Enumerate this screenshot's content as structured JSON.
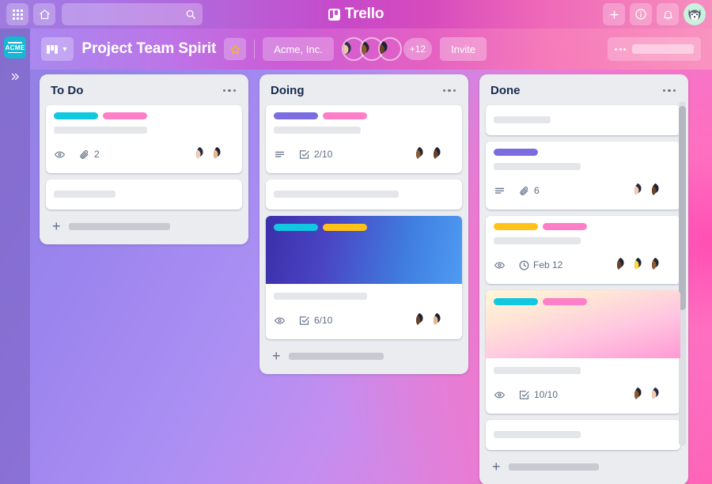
{
  "topnav": {
    "apps_icon": "grid-apps-icon",
    "home_icon": "home-icon",
    "search": {
      "value": "",
      "placeholder": "",
      "icon": "search-icon"
    },
    "brand": {
      "text": "Trello",
      "logo_icon": "trello-logo-icon"
    },
    "add_icon": "plus-icon",
    "info_icon": "info-icon",
    "notifications_icon": "bell-icon",
    "profile_avatar": "husky-avatar",
    "colors": {
      "gradient_start": "#9f7be0",
      "gradient_end": "#f58fbe"
    }
  },
  "sidebar": {
    "workspace_logo_text": "ACME",
    "workspace_logo_color": "#17b8d4",
    "expand_icon": "chevron-double-right-icon"
  },
  "boardbar": {
    "board_switch_icon": "board-icon",
    "board_switch_chevron": "chevron-down-icon",
    "title": "Project Team Spirit",
    "star_icon": "star-icon",
    "organization": "Acme, Inc.",
    "members_overflow": "+12",
    "invite_label": "Invite",
    "overflow_menu_icon": "ellipsis-icon",
    "members": [
      {
        "name": "member-1"
      },
      {
        "name": "member-2"
      },
      {
        "name": "member-3"
      }
    ]
  },
  "lists": [
    {
      "title": "To Do",
      "menu_icon": "ellipsis-icon",
      "has_scrollbar": false,
      "add_card_label": "",
      "cards": [
        {
          "cover": null,
          "labels": [
            "#12c7e0",
            "#ff7ec8"
          ],
          "title_placeholder_width": 118,
          "badges": [
            {
              "icon": "eye-icon",
              "text": ""
            },
            {
              "icon": "attachment-icon",
              "text": "2"
            }
          ],
          "avatars": [
            "member-4",
            "member-5"
          ]
        },
        {
          "cover": null,
          "labels": [],
          "title_placeholder_width": 78,
          "badges": [],
          "avatars": []
        }
      ]
    },
    {
      "title": "Doing",
      "menu_icon": "ellipsis-icon",
      "has_scrollbar": false,
      "add_card_label": "",
      "cards": [
        {
          "cover": null,
          "labels": [
            "#7b6ce0",
            "#ff7ec8"
          ],
          "title_placeholder_width": 110,
          "badges": [
            {
              "icon": "description-icon",
              "text": ""
            },
            {
              "icon": "checklist-icon",
              "text": "2/10"
            }
          ],
          "avatars": [
            "member-6",
            "member-7"
          ]
        },
        {
          "cover": null,
          "labels": [],
          "title_placeholder_width": 158,
          "badges": [],
          "avatars": []
        },
        {
          "cover": "cover-blue",
          "labels": [
            "#12c7e0",
            "#ffc218"
          ],
          "title_placeholder_width": 118,
          "badges": [
            {
              "icon": "eye-icon",
              "text": ""
            },
            {
              "icon": "checklist-icon",
              "text": "6/10"
            }
          ],
          "avatars": [
            "member-8",
            "member-9"
          ]
        }
      ]
    },
    {
      "title": "Done",
      "menu_icon": "ellipsis-icon",
      "has_scrollbar": true,
      "add_card_label": "",
      "cards": [
        {
          "cover": null,
          "labels": [],
          "title_placeholder_width": 72,
          "badges": [],
          "avatars": []
        },
        {
          "cover": null,
          "labels": [
            "#7b6ce0"
          ],
          "title_placeholder_width": 110,
          "badges": [
            {
              "icon": "description-icon",
              "text": ""
            },
            {
              "icon": "attachment-icon",
              "text": "6"
            }
          ],
          "avatars": [
            "member-10",
            "member-11"
          ]
        },
        {
          "cover": null,
          "labels": [
            "#ffc218",
            "#ff7ec8"
          ],
          "title_placeholder_width": 110,
          "badges": [
            {
              "icon": "eye-icon",
              "text": ""
            },
            {
              "icon": "clock-icon",
              "text": "Feb 12"
            }
          ],
          "avatars": [
            "member-12",
            "member-13",
            "member-14"
          ]
        },
        {
          "cover": "cover-pink",
          "labels": [
            "#12c7e0",
            "#ff7ec8"
          ],
          "title_placeholder_width": 110,
          "badges": [
            {
              "icon": "eye-icon",
              "text": ""
            },
            {
              "icon": "checklist-icon",
              "text": "10/10"
            }
          ],
          "avatars": [
            "member-15",
            "member-16"
          ]
        },
        {
          "cover": null,
          "labels": [],
          "title_placeholder_width": 110,
          "badges": [],
          "avatars": []
        }
      ]
    }
  ]
}
